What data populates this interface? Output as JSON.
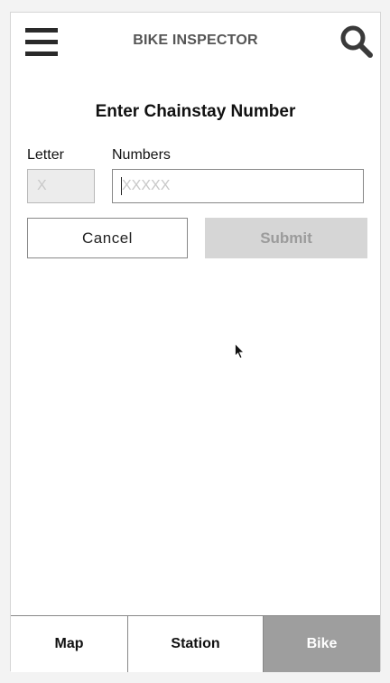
{
  "header": {
    "title": "BIKE INSPECTOR",
    "menu_icon": "hamburger-menu-icon",
    "search_icon": "search-icon"
  },
  "form": {
    "title": "Enter Chainstay Number",
    "letter_label": "Letter",
    "letter_placeholder": "X",
    "numbers_label": "Numbers",
    "numbers_placeholder": "XXXXX",
    "cancel_label": "Cancel",
    "submit_label": "Submit"
  },
  "tabs": [
    {
      "label": "Map"
    },
    {
      "label": "Station"
    },
    {
      "label": "Bike",
      "active": true
    }
  ],
  "colors": {
    "active_tab": "#9e9e9e",
    "disabled_button": "#d6d6d6"
  }
}
